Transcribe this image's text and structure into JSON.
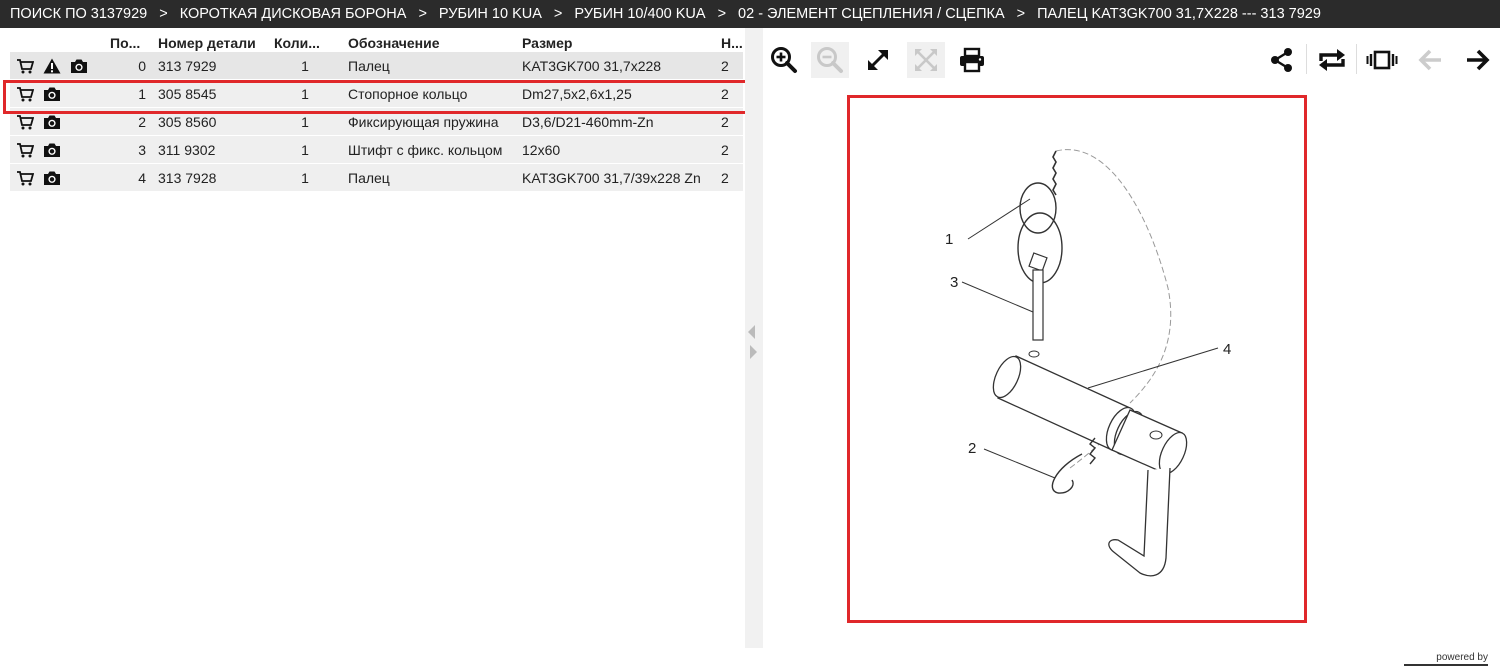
{
  "breadcrumb": [
    "ПОИСК ПО 3137929",
    "КОРОТКАЯ ДИСКОВАЯ БОРОНА",
    "РУБИН 10 KUA",
    "РУБИН 10/400 KUA",
    "02 - ЭЛЕМЕНТ СЦЕПЛЕНИЯ / СЦЕПКА",
    "ПАЛЕЦ KAT3GK700 31,7X228 --- 313 7929"
  ],
  "breadcrumb_separator": ">",
  "table": {
    "headers": {
      "pos": "По...",
      "number": "Номер детали",
      "qty": "Коли...",
      "name": "Обозначение",
      "size": "Размер",
      "n": "Н..."
    },
    "rows": [
      {
        "pos": "0",
        "number": "313 7929",
        "qty": "1",
        "name": "Палец",
        "size": "KAT3GK700 31,7x228",
        "n": "2",
        "warning": true
      },
      {
        "pos": "1",
        "number": "305 8545",
        "qty": "1",
        "name": "Стопорное кольцо",
        "size": "Dm27,5x2,6x1,25",
        "n": "2",
        "warning": false
      },
      {
        "pos": "2",
        "number": "305 8560",
        "qty": "1",
        "name": "Фиксирующая пружина",
        "size": "D3,6/D21-460mm-Zn",
        "n": "2",
        "warning": false
      },
      {
        "pos": "3",
        "number": "311 9302",
        "qty": "1",
        "name": "Штифт с фикс. кольцом",
        "size": "12x60",
        "n": "2",
        "warning": false
      },
      {
        "pos": "4",
        "number": "313 7928",
        "qty": "1",
        "name": "Палец",
        "size": "KAT3GK700 31,7/39x228 Zn",
        "n": "2",
        "warning": false
      }
    ]
  },
  "row_icons": [
    "cart-icon",
    "warning-icon",
    "camera-icon"
  ],
  "toolbar": {
    "buttons": [
      "zoom-in-icon",
      "zoom-out-icon",
      "expand-icon",
      "fit-icon",
      "print-icon",
      "share-icon",
      "swap-icon",
      "carousel-icon",
      "arrow-left-icon",
      "arrow-right-icon"
    ]
  },
  "drawing": {
    "callouts": [
      "1",
      "2",
      "3",
      "4"
    ]
  },
  "footer": {
    "text": "powered by"
  },
  "colors": {
    "highlight": "#e0282a",
    "topbar": "#2b2b2b",
    "row": "#efefef"
  }
}
